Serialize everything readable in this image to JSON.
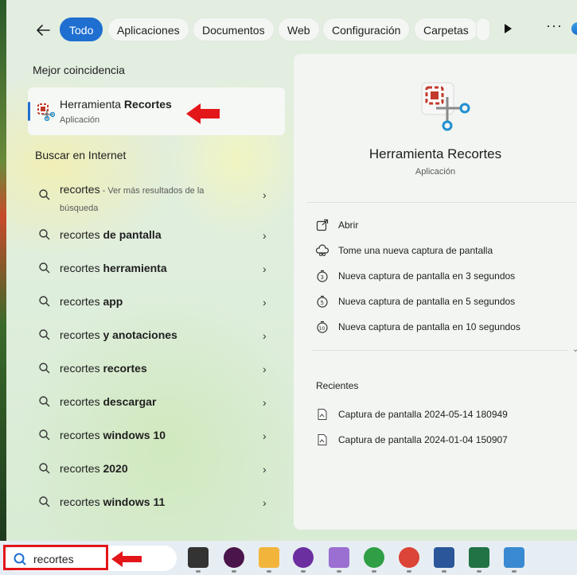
{
  "tabs": [
    "Todo",
    "Aplicaciones",
    "Documentos",
    "Web",
    "Configuración",
    "Carpetas"
  ],
  "best_match": {
    "heading": "Mejor coincidencia",
    "app_name_prefix": "Herramienta ",
    "app_name_bold": "Recortes",
    "app_type": "Aplicación"
  },
  "web": {
    "heading": "Buscar en Internet",
    "first": {
      "query": "recortes",
      "suffix": " - Ver más resultados de la búsqueda"
    },
    "results": [
      {
        "query": "recortes ",
        "bold": "de pantalla"
      },
      {
        "query": "recortes ",
        "bold": "herramienta"
      },
      {
        "query": "recortes ",
        "bold": "app"
      },
      {
        "query": "recortes ",
        "bold": "y anotaciones"
      },
      {
        "query": "recortes ",
        "bold": "recortes"
      },
      {
        "query": "recortes ",
        "bold": "descargar"
      },
      {
        "query": "recortes ",
        "bold": "windows 10"
      },
      {
        "query": "recortes ",
        "bold": "2020"
      },
      {
        "query": "recortes ",
        "bold": "windows 11"
      }
    ]
  },
  "detail": {
    "title": "Herramienta Recortes",
    "subtitle": "Aplicación",
    "actions": [
      {
        "label": "Abrir",
        "icon": "open-icon"
      },
      {
        "label": "Tome una nueva captura de pantalla",
        "icon": "snip-cloud-icon"
      },
      {
        "label": "Nueva captura de pantalla en 3 segundos",
        "icon": "timer-3-icon"
      },
      {
        "label": "Nueva captura de pantalla en 5 segundos",
        "icon": "timer-5-icon"
      },
      {
        "label": "Nueva captura de pantalla en 10 segundos",
        "icon": "timer-10-icon"
      }
    ],
    "recent_heading": "Recientes",
    "recent": [
      "Captura de pantalla 2024-05-14 180949",
      "Captura de pantalla 2024-01-04 150907"
    ]
  },
  "taskbar": {
    "search_value": "recortes",
    "apps": [
      "task-view-icon",
      "slack-icon",
      "file-explorer-icon",
      "app-purple-icon",
      "feather-icon",
      "chrome-y-icon",
      "chrome-s-icon",
      "word-icon",
      "excel-icon",
      "paint-icon"
    ]
  },
  "colors": {
    "accent": "#1f6fd1",
    "annotation_red": "#e3161a"
  }
}
